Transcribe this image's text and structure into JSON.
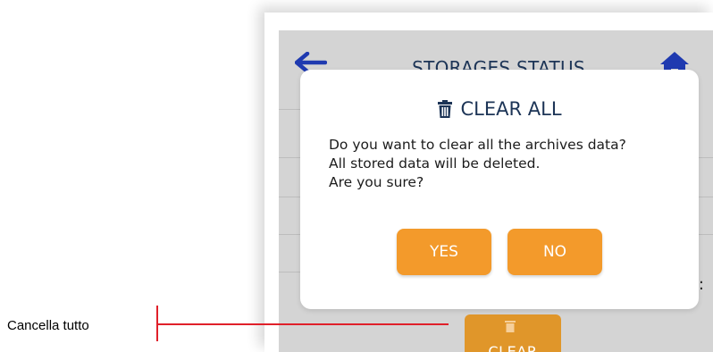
{
  "screen": {
    "header_title": "STORAGES STATUS",
    "back_icon": "arrow-left-icon",
    "home_icon": "home-icon",
    "edge_glyph": ":"
  },
  "clear_button": {
    "label": "CLEAR",
    "icon": "trash-icon"
  },
  "dialog": {
    "title": "CLEAR ALL",
    "title_icon": "trash-icon",
    "message_lines": [
      "Do you want to clear all the archives data?",
      "All stored data will be deleted.",
      "Are you sure?"
    ],
    "yes_label": "YES",
    "no_label": "NO"
  },
  "annotation": {
    "label": "Cancella tutto",
    "color": "#e0202a"
  },
  "colors": {
    "accent": "#f39a2b",
    "navy": "#1c3456",
    "icon_blue": "#1f3ab0"
  }
}
